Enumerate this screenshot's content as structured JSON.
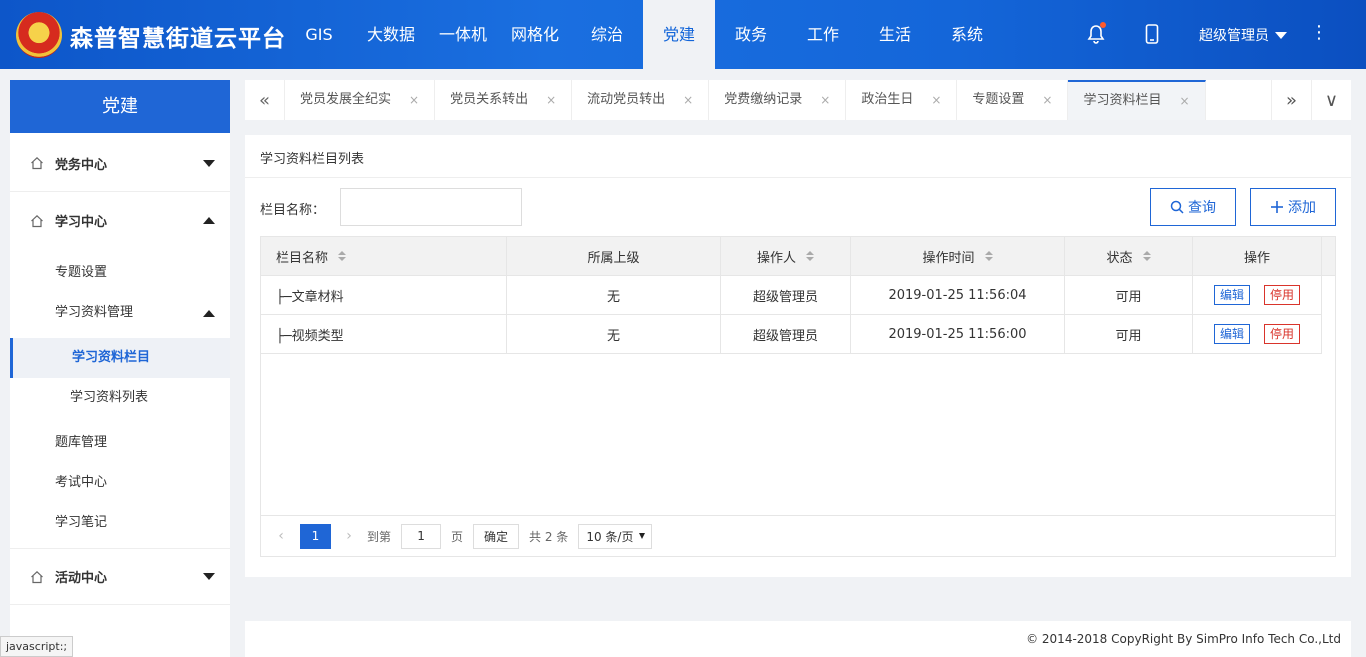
{
  "header": {
    "brand": "森普智慧街道云平台",
    "nav": [
      "GIS",
      "大数据",
      "一体机",
      "网格化",
      "综治",
      "党建",
      "政务",
      "工作",
      "生活",
      "系统"
    ],
    "active_nav": "党建",
    "user": "超级管理员",
    "more": "⋮",
    "colors": {
      "primary": "#1466d9",
      "notify_dot": "#ff5a2b"
    }
  },
  "sidebar": {
    "title": "党建",
    "groups": [
      {
        "label": "党务中心"
      },
      {
        "label": "学习中心"
      },
      {
        "label": "活动中心"
      }
    ],
    "items": [
      "专题设置",
      "学习资料管理",
      "学习资料栏目",
      "学习资料列表",
      "题库管理",
      "考试中心",
      "学习笔记"
    ],
    "selected": "学习资料栏目"
  },
  "tabs": {
    "prev": "«",
    "next": "»",
    "dropdown": "∨",
    "items": [
      "党员发展全纪实",
      "党员关系转出",
      "流动党员转出",
      "党费缴纳记录",
      "政治生日",
      "专题设置",
      "学习资料栏目"
    ],
    "active": "学习资料栏目",
    "close": "×"
  },
  "panel": {
    "title": "学习资料栏目列表",
    "filter_label": "栏目名称：",
    "filter_value": "",
    "query_label": "查询",
    "add_label": "添加"
  },
  "table": {
    "columns": [
      "栏目名称",
      "所属上级",
      "操作人",
      "操作时间",
      "状态",
      "操作"
    ],
    "rows": [
      {
        "name": "├─文章材料",
        "parent": "无",
        "operator": "超级管理员",
        "time": "2019-01-25 11:56:04",
        "status": "可用",
        "edit": "编辑",
        "disable": "停用"
      },
      {
        "name": "├─视频类型",
        "parent": "无",
        "operator": "超级管理员",
        "time": "2019-01-25 11:56:00",
        "status": "可用",
        "edit": "编辑",
        "disable": "停用"
      }
    ]
  },
  "pager": {
    "prev": "‹",
    "next": "›",
    "current": "1",
    "goto_label": "到第",
    "goto_value": "1",
    "page_label": "页",
    "confirm": "确定",
    "total": "共 2 条",
    "page_size": "10 条/页"
  },
  "footer": {
    "copyright": "© 2014-2018 CopyRight By SimPro Info Tech Co.,Ltd"
  },
  "status_bar": "javascript:;"
}
